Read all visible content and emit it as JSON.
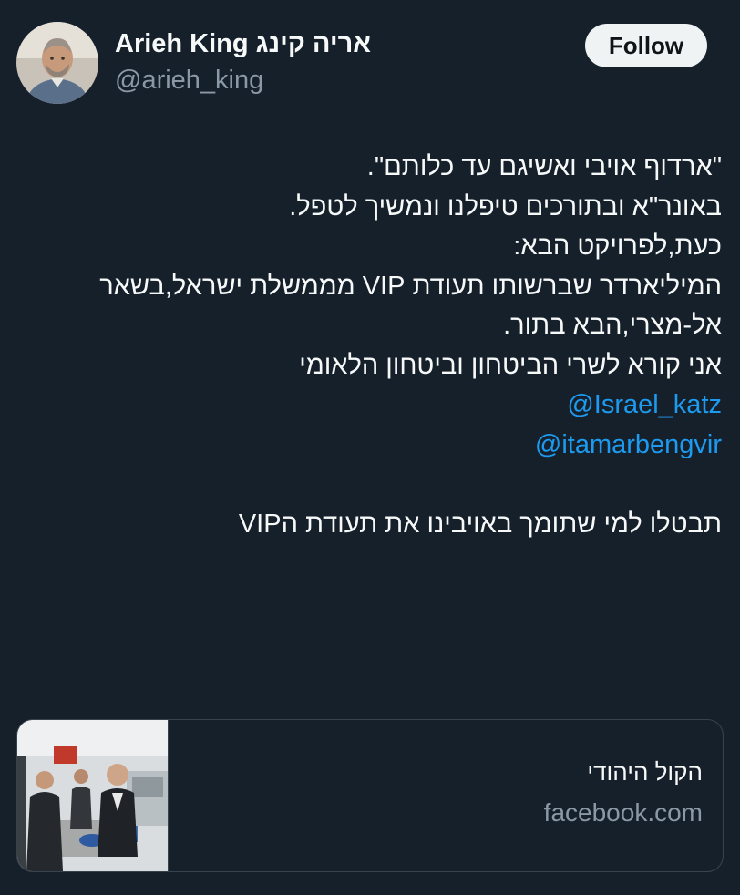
{
  "author": {
    "display_name": "Arieh King אריה קינג",
    "handle": "@arieh_king",
    "avatar_icon": "profile-photo"
  },
  "follow_button": {
    "label": "Follow"
  },
  "tweet": {
    "lines": [
      "\"ארדוף אויבי ואשיגם עד כלותם\".",
      "באונר\"א ובתורכים טיפלנו ונמשיך לטפל.",
      "כעת,לפרויקט הבא:",
      "המיליארדר שברשותו תעודת VIP מממשלת ישראל,בשאר",
      "אל-מצרי,הבא בתור.",
      "אני קורא לשרי הביטחון וביטחון הלאומי"
    ],
    "mentions": [
      "@Israel_katz",
      "@itamarbengvir"
    ],
    "closing_line": "תבטלו למי שתומך באויבינו את תעודת הVIP"
  },
  "link_card": {
    "title": "הקול היהודי",
    "domain": "facebook.com",
    "thumbnail_icon": "news-photo-thumbnail"
  },
  "colors": {
    "background": "#15202b",
    "text": "#f7f9f9",
    "secondary_text": "#8b98a5",
    "link": "#1d9bf0",
    "border": "#38444d",
    "button_bg": "#eff3f4"
  }
}
